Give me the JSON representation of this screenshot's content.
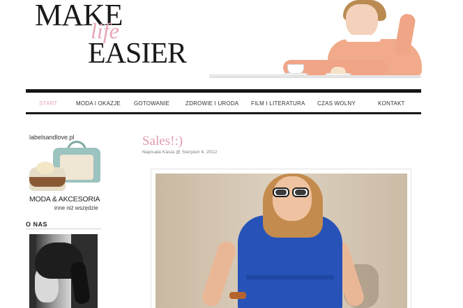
{
  "header": {
    "logo_make": "MAKE",
    "logo_life": "life",
    "logo_easier": "EASIER"
  },
  "nav": {
    "items": [
      {
        "label": "START",
        "active": true
      },
      {
        "label": "MODA I OKAZJE",
        "active": false
      },
      {
        "label": "GOTOWANIE",
        "active": false
      },
      {
        "label": "ZDROWIE I URODA",
        "active": false
      },
      {
        "label": "FILM I LITERATURA",
        "active": false
      },
      {
        "label": "CZAS WOLNY",
        "active": false
      },
      {
        "label": "KONTAKT",
        "active": false
      }
    ]
  },
  "sidebar": {
    "ad": {
      "url": "labelsandlove.pl",
      "title": "MODA & AKCESORIA",
      "subtitle": "inne niż wszędzie"
    },
    "about_title": "O NAS"
  },
  "post": {
    "title": "Sales!:)",
    "meta": "Napisała Kasia @ Sierpień 4, 2012"
  },
  "colors": {
    "accent_pink": "#e29aad",
    "nav_bar": "#151515",
    "dress_blue": "#2753b8"
  }
}
